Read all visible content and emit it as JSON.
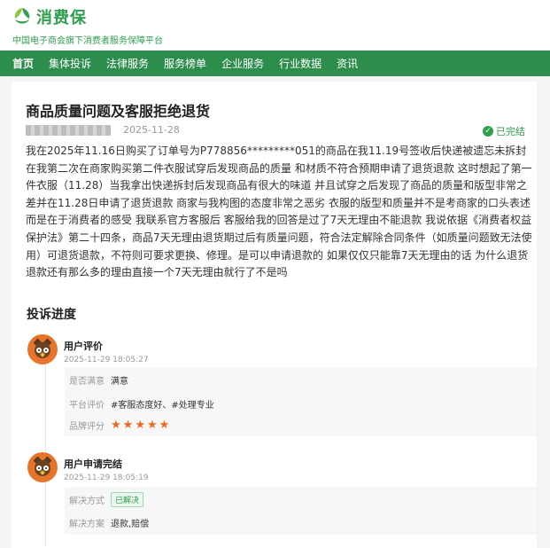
{
  "brand": {
    "name": "消费保",
    "tagline": "中国电子商会旗下消费者服务保障平台",
    "color": "#2e9e4f"
  },
  "nav": {
    "items": [
      "首页",
      "集体投诉",
      "法律服务",
      "服务榜单",
      "企业服务",
      "行业数据",
      "资讯"
    ],
    "active_index": 0,
    "bg_color": "#2d8d4d"
  },
  "complaint": {
    "title": "商品质量问题及客服拒绝退货",
    "date": "2025-11-28",
    "status": "已完结",
    "body": "我在2025年11.16日购买了订单号为P778856*********051的商品在我11.19号签收后快递被遗忘未拆封 在我第二次在商家购买第二件衣服试穿后发现商品的质量 和材质不符合预期申请了退货退款 这时想起了第一件衣服（11.28）当我拿出快递拆封后发现商品有很大的味道 并且试穿之后发现了商品的质量和版型非常之差并在11.28日申请了退货退款 商家与我构图的态度非常之恶劣 衣服的版型和质量并不是考商家的口头表述而是在于消费者的感受 我联系官方客服后 客服给我的回答是过了7天无理由不能退款 我说依据《消费者权益保护法》第二十四条，商品7天无理由退货期过后有质量问题，符合法定解除合同条件（如质量问题致无法使用）可退货退款，不符则可要求更换、修理。是可以申请退款的 如果仅仅只能靠7天无理由的话 为什么退货退款还有那么多的理由直接一个7天无理由就行了不是吗"
  },
  "progress": {
    "section_title": "投诉进度",
    "entries": [
      {
        "title": "用户评价",
        "time": "2025-11-29 18:05:27",
        "satisfied_label": "是否满意",
        "satisfied_value": "满意",
        "platform_label": "平台评价",
        "platform_tags": "#客服态度好、#处理专业",
        "brand_label": "品牌评分",
        "brand_rating": 5
      },
      {
        "title": "用户申请完结",
        "time": "2025-11-29 18:05:19",
        "method_label": "解决方式",
        "method_value": "已解决",
        "plan_label": "解决方案",
        "plan_value": "退款,赔偿"
      }
    ]
  }
}
